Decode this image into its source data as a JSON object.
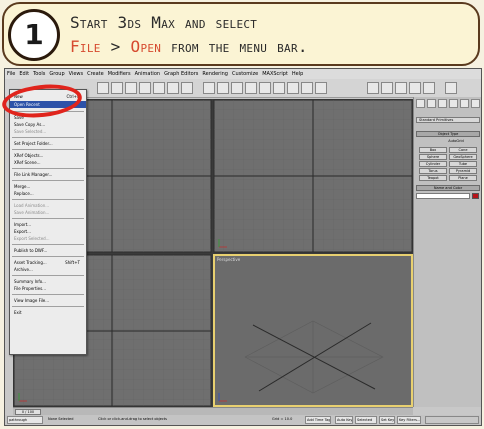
{
  "banner": {
    "step_number": "1",
    "line1": "Start 3ds Max and select",
    "line2_part1": "File",
    "line2_sep": " > ",
    "line2_part2": "Open",
    "line2_part3": " from the menu bar."
  },
  "menubar": {
    "items": [
      "File",
      "Edit",
      "Tools",
      "Group",
      "Views",
      "Create",
      "Modifiers",
      "Animation",
      "Graph Editors",
      "Rendering",
      "Customize",
      "MAXScript",
      "Help"
    ]
  },
  "file_menu": {
    "items": [
      {
        "label": "New",
        "shortcut": "Ctrl+N",
        "state": "normal"
      },
      {
        "label": "Open Recent",
        "shortcut": "",
        "state": "selected"
      },
      {
        "label": "Save",
        "shortcut": "",
        "state": "normal"
      },
      {
        "label": "Save Copy As...",
        "shortcut": "",
        "state": "normal"
      },
      {
        "label": "Save Selected...",
        "shortcut": "",
        "state": "disabled"
      },
      {
        "label": "Set Project Folder...",
        "shortcut": "",
        "state": "normal"
      },
      {
        "label": "XRef Objects...",
        "shortcut": "",
        "state": "normal"
      },
      {
        "label": "XRef Scene...",
        "shortcut": "",
        "state": "normal"
      },
      {
        "label": "File Link Manager...",
        "shortcut": "",
        "state": "normal"
      },
      {
        "label": "Merge...",
        "shortcut": "",
        "state": "normal"
      },
      {
        "label": "Replace...",
        "shortcut": "",
        "state": "normal"
      },
      {
        "label": "Load Animation...",
        "shortcut": "",
        "state": "disabled"
      },
      {
        "label": "Save Animation...",
        "shortcut": "",
        "state": "disabled"
      },
      {
        "label": "Import...",
        "shortcut": "",
        "state": "normal"
      },
      {
        "label": "Export...",
        "shortcut": "",
        "state": "normal"
      },
      {
        "label": "Export Selected...",
        "shortcut": "",
        "state": "disabled"
      },
      {
        "label": "Publish to DWF...",
        "shortcut": "",
        "state": "normal"
      },
      {
        "label": "Asset Tracking...",
        "shortcut": "Shift+T",
        "state": "normal"
      },
      {
        "label": "Archive...",
        "shortcut": "",
        "state": "normal"
      },
      {
        "label": "Summary Info...",
        "shortcut": "",
        "state": "normal"
      },
      {
        "label": "File Properties...",
        "shortcut": "",
        "state": "normal"
      },
      {
        "label": "View Image File...",
        "shortcut": "",
        "state": "normal"
      },
      {
        "label": "Exit",
        "shortcut": "",
        "state": "normal"
      }
    ]
  },
  "command_panel": {
    "dropdown": "Standard Primitives",
    "object_type_header": "Object Type",
    "autogrid": "AutoGrid",
    "buttons": [
      "Box",
      "Cone",
      "Sphere",
      "GeoSphere",
      "Cylinder",
      "Tube",
      "Torus",
      "Pyramid",
      "Teapot",
      "Plane"
    ],
    "name_color_header": "Name and Color"
  },
  "viewports": {
    "active_label": "Perspective"
  },
  "timeslider": {
    "counter": "0 / 100"
  },
  "statusbar": {
    "selection": "None Selected",
    "prompt": "Click or click-and-drag to select objects",
    "grid": "Grid = 10.0",
    "autokey": "Auto Key",
    "selected": "Selected",
    "setkey": "Set Key",
    "keyfilters": "Key Filters...",
    "addtimetag": "Add Time Tag",
    "script_listener": "pathrough"
  },
  "colors": {
    "accent_red": "#e0241c",
    "banner_red_text": "#d64a2f",
    "menu_selection": "#2d52a8",
    "active_viewport_border": "#e8d070"
  }
}
